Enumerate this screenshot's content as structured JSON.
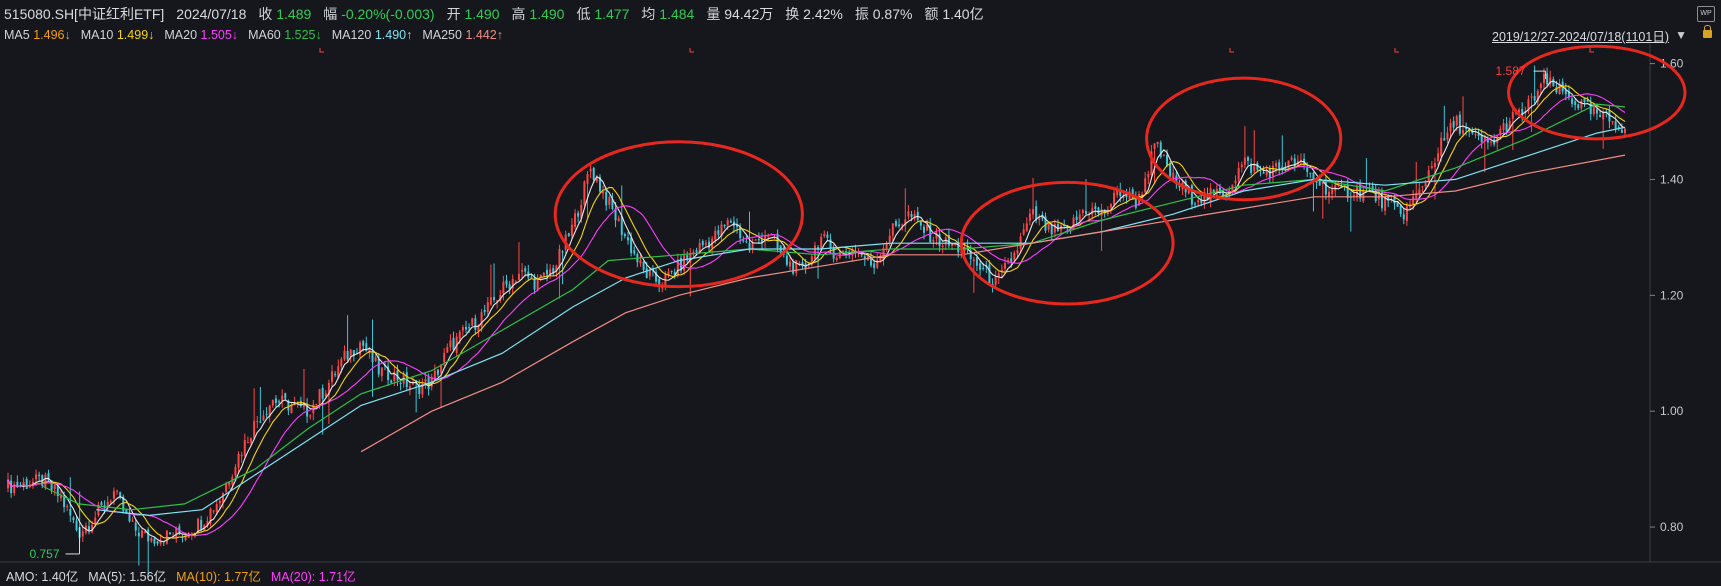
{
  "header": {
    "symbol": "515080.SH[中证红利ETF]",
    "date": "2024/07/18",
    "close_label": "收",
    "close": "1.489",
    "change_label": "幅",
    "change": "-0.20%(-0.003)",
    "open_label": "开",
    "open": "1.490",
    "high_label": "高",
    "high": "1.490",
    "low_label": "低",
    "low": "1.477",
    "avg_label": "均",
    "avg": "1.484",
    "volume_label": "量",
    "volume": "94.42万",
    "turnover_label": "换",
    "turnover": "2.42%",
    "amplitude_label": "振",
    "amplitude": "0.87%",
    "amount_label": "额",
    "amount": "1.40亿"
  },
  "ma_bar": {
    "ma5_label": "MA5",
    "ma5": "1.496↓",
    "ma10_label": "MA10",
    "ma10": "1.499↓",
    "ma20_label": "MA20",
    "ma20": "1.505↓",
    "ma60_label": "MA60",
    "ma60": "1.525↓",
    "ma120_label": "MA120",
    "ma120": "1.490↑",
    "ma250_label": "MA250",
    "ma250": "1.442↑",
    "range": "2019/12/27-2024/07/18(1101日)",
    "wp_icon_text": "WP"
  },
  "amo_bar": {
    "amo": "AMO: 1.40亿",
    "ma5": "MA(5): 1.56亿",
    "ma10": "MA(10): 1.77亿",
    "ma20": "MA(20): 1.71亿"
  },
  "colors": {
    "ma5": "#e8e8e8",
    "ma10": "#f5d30d",
    "ma20": "#ff3dff",
    "ma60": "#2fbf4a",
    "ma120": "#7fe3f2",
    "ma250": "#f08c84",
    "up": "#ff4646",
    "down": "#3fc6d8",
    "circle": "#e8281e",
    "green_text": "#2ecc57",
    "ma10_amo": "#f2a10d"
  },
  "chart_data": {
    "type": "candlestick",
    "ylim": [
      0.75,
      1.62
    ],
    "yticks": [
      0.8,
      1.0,
      1.2,
      1.4,
      1.6
    ],
    "ytick_labels": [
      "0.80",
      "1.00",
      "1.20",
      "1.40",
      "1.60"
    ],
    "annotations": [
      {
        "text": "0.757",
        "value": 0.757
      },
      {
        "text": "1.587",
        "value": 1.587
      }
    ],
    "price_path": [
      [
        0,
        0.87
      ],
      [
        2,
        0.88
      ],
      [
        3,
        0.85
      ],
      [
        4,
        0.79
      ],
      [
        5,
        0.82
      ],
      [
        6,
        0.86
      ],
      [
        7,
        0.8
      ],
      [
        8,
        0.78
      ],
      [
        10,
        0.79
      ],
      [
        11,
        0.81
      ],
      [
        12,
        0.85
      ],
      [
        13,
        0.92
      ],
      [
        14,
        0.98
      ],
      [
        15,
        1.02
      ],
      [
        17,
        1.0
      ],
      [
        18,
        1.04
      ],
      [
        19,
        1.09
      ],
      [
        20,
        1.12
      ],
      [
        21,
        1.07
      ],
      [
        22,
        1.06
      ],
      [
        23,
        1.04
      ],
      [
        24,
        1.05
      ],
      [
        25,
        1.11
      ],
      [
        26,
        1.14
      ],
      [
        27,
        1.17
      ],
      [
        28,
        1.21
      ],
      [
        29,
        1.24
      ],
      [
        30,
        1.22
      ],
      [
        31,
        1.25
      ],
      [
        32,
        1.32
      ],
      [
        33,
        1.42
      ],
      [
        34,
        1.36
      ],
      [
        35,
        1.3
      ],
      [
        36,
        1.24
      ],
      [
        37,
        1.22
      ],
      [
        38,
        1.25
      ],
      [
        39,
        1.28
      ],
      [
        40,
        1.3
      ],
      [
        41,
        1.33
      ],
      [
        42,
        1.28
      ],
      [
        43,
        1.31
      ],
      [
        44,
        1.26
      ],
      [
        45,
        1.24
      ],
      [
        46,
        1.3
      ],
      [
        47,
        1.27
      ],
      [
        48,
        1.28
      ],
      [
        49,
        1.25
      ],
      [
        50,
        1.31
      ],
      [
        51,
        1.34
      ],
      [
        52,
        1.31
      ],
      [
        53,
        1.29
      ],
      [
        54,
        1.28
      ],
      [
        55,
        1.25
      ],
      [
        56,
        1.22
      ],
      [
        57,
        1.27
      ],
      [
        58,
        1.34
      ],
      [
        59,
        1.31
      ],
      [
        60,
        1.31
      ],
      [
        61,
        1.35
      ],
      [
        62,
        1.34
      ],
      [
        63,
        1.38
      ],
      [
        64,
        1.36
      ],
      [
        65,
        1.46
      ],
      [
        66,
        1.4
      ],
      [
        67,
        1.37
      ],
      [
        68,
        1.37
      ],
      [
        69,
        1.38
      ],
      [
        70,
        1.43
      ],
      [
        71,
        1.41
      ],
      [
        72,
        1.42
      ],
      [
        73,
        1.43
      ],
      [
        74,
        1.4
      ],
      [
        75,
        1.38
      ],
      [
        76,
        1.38
      ],
      [
        77,
        1.38
      ],
      [
        78,
        1.36
      ],
      [
        79,
        1.34
      ],
      [
        80,
        1.38
      ],
      [
        81,
        1.45
      ],
      [
        82,
        1.5
      ],
      [
        83,
        1.47
      ],
      [
        84,
        1.46
      ],
      [
        85,
        1.5
      ],
      [
        86,
        1.52
      ],
      [
        87,
        1.57
      ],
      [
        88,
        1.55
      ],
      [
        89,
        1.53
      ],
      [
        90,
        1.51
      ],
      [
        91,
        1.5
      ],
      [
        91.6,
        1.489
      ]
    ],
    "ma60_path": [
      [
        2,
        0.87
      ],
      [
        4,
        0.84
      ],
      [
        7,
        0.83
      ],
      [
        10,
        0.84
      ],
      [
        14,
        0.9
      ],
      [
        17,
        0.97
      ],
      [
        20,
        1.03
      ],
      [
        24,
        1.07
      ],
      [
        28,
        1.14
      ],
      [
        32,
        1.21
      ],
      [
        34,
        1.26
      ],
      [
        38,
        1.27
      ],
      [
        42,
        1.28
      ],
      [
        46,
        1.27
      ],
      [
        50,
        1.28
      ],
      [
        54,
        1.28
      ],
      [
        58,
        1.29
      ],
      [
        62,
        1.33
      ],
      [
        66,
        1.36
      ],
      [
        70,
        1.39
      ],
      [
        74,
        1.4
      ],
      [
        78,
        1.38
      ],
      [
        82,
        1.42
      ],
      [
        86,
        1.47
      ],
      [
        90,
        1.53
      ],
      [
        91.6,
        1.525
      ]
    ],
    "ma120_path": [
      [
        5,
        0.83
      ],
      [
        8,
        0.82
      ],
      [
        11,
        0.83
      ],
      [
        14,
        0.89
      ],
      [
        17,
        0.95
      ],
      [
        20,
        1.01
      ],
      [
        24,
        1.05
      ],
      [
        28,
        1.1
      ],
      [
        32,
        1.18
      ],
      [
        35,
        1.23
      ],
      [
        38,
        1.26
      ],
      [
        42,
        1.28
      ],
      [
        46,
        1.28
      ],
      [
        50,
        1.29
      ],
      [
        54,
        1.29
      ],
      [
        58,
        1.29
      ],
      [
        62,
        1.31
      ],
      [
        66,
        1.34
      ],
      [
        70,
        1.38
      ],
      [
        74,
        1.4
      ],
      [
        78,
        1.39
      ],
      [
        82,
        1.4
      ],
      [
        86,
        1.44
      ],
      [
        90,
        1.48
      ],
      [
        91.6,
        1.49
      ]
    ],
    "ma250_path": [
      [
        20,
        0.93
      ],
      [
        24,
        1.0
      ],
      [
        28,
        1.05
      ],
      [
        32,
        1.12
      ],
      [
        35,
        1.17
      ],
      [
        38,
        1.2
      ],
      [
        42,
        1.23
      ],
      [
        46,
        1.25
      ],
      [
        50,
        1.27
      ],
      [
        54,
        1.27
      ],
      [
        58,
        1.29
      ],
      [
        62,
        1.31
      ],
      [
        66,
        1.33
      ],
      [
        70,
        1.35
      ],
      [
        74,
        1.37
      ],
      [
        78,
        1.37
      ],
      [
        82,
        1.38
      ],
      [
        86,
        1.41
      ],
      [
        91.6,
        1.442
      ]
    ],
    "annotated_circles": [
      {
        "x": 38,
        "y": 1.34,
        "rx": 7.0,
        "ry": 0.125
      },
      {
        "x": 60,
        "y": 1.29,
        "rx": 6.0,
        "ry": 0.105
      },
      {
        "x": 70,
        "y": 1.47,
        "rx": 5.5,
        "ry": 0.105
      },
      {
        "x": 90,
        "y": 1.55,
        "rx": 5.0,
        "ry": 0.08
      }
    ]
  }
}
